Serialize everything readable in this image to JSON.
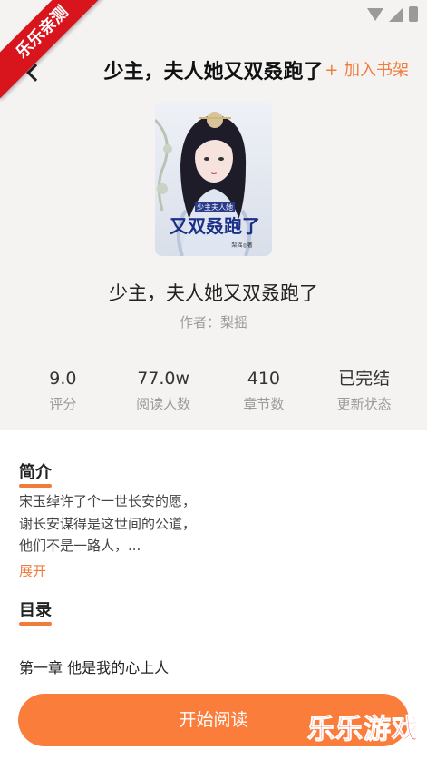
{
  "header": {
    "title": "少主，夫人她又双叒跑了",
    "add_shelf": "+ 加入书架",
    "watermark_corner": "乐乐亲测"
  },
  "book": {
    "cover_title_small": "少主夫人她",
    "cover_title_large": "又双叒跑了",
    "cover_author_mark": "梨摇◎著",
    "title": "少主，夫人她又双叒跑了",
    "author_line": "作者：梨摇"
  },
  "stats": [
    {
      "value": "9.0",
      "label": "评分"
    },
    {
      "value": "77.0w",
      "label": "阅读人数"
    },
    {
      "value": "410",
      "label": "章节数"
    },
    {
      "value": "已完结",
      "label": "更新状态"
    }
  ],
  "intro": {
    "heading": "简介",
    "lines": [
      "宋玉绰许了个一世长安的愿，",
      "谢长安谋得是这世间的公道，",
      "他们不是一路人，..."
    ],
    "expand": "展开"
  },
  "catalog": {
    "heading": "目录",
    "first_chapter": "第一章 他是我的心上人"
  },
  "actions": {
    "start_reading": "开始阅读"
  },
  "watermark_bottom": {
    "text": "乐乐游戏",
    "url": "www.6ll.com"
  },
  "colors": {
    "accent": "#f07c3c",
    "button": "#fb7d3b",
    "header_bg": "#f4f3f2"
  }
}
